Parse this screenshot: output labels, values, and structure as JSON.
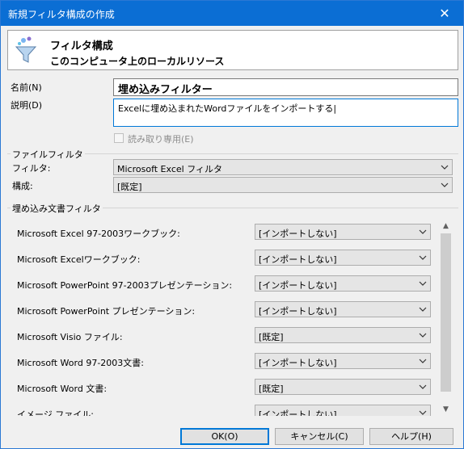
{
  "window": {
    "title": "新規フィルタ構成の作成",
    "close_glyph": "✕"
  },
  "header": {
    "title": "フィルタ構成",
    "subtitle": "このコンピュータ上のローカルリソース",
    "icon": "funnel-icon"
  },
  "form": {
    "name_label": "名前(N)",
    "name_value": "埋め込みフィルター",
    "desc_label": "説明(D)",
    "desc_value": "Excelに埋め込まれたWordファイルをインポートする|",
    "readonly_label": "読み取り専用(E)"
  },
  "file_filter": {
    "group_title": "ファイルフィルタ",
    "filter_label": "フィルタ:",
    "filter_value": "Microsoft Excel フィルタ",
    "config_label": "構成:",
    "config_value": "[既定]"
  },
  "embedded": {
    "group_title": "埋め込み文書フィルタ",
    "rows": [
      {
        "label": "Microsoft Excel 97-2003ワークブック:",
        "value": "[インポートしない]"
      },
      {
        "label": "Microsoft Excelワークブック:",
        "value": "[インポートしない]"
      },
      {
        "label": "Microsoft PowerPoint 97-2003プレゼンテーション:",
        "value": "[インポートしない]"
      },
      {
        "label": "Microsoft PowerPoint プレゼンテーション:",
        "value": "[インポートしない]"
      },
      {
        "label": "Microsoft Visio ファイル:",
        "value": "[既定]"
      },
      {
        "label": "Microsoft Word 97-2003文書:",
        "value": "[インポートしない]"
      },
      {
        "label": "Microsoft Word 文書:",
        "value": "[既定]"
      },
      {
        "label": "イメージ ファイル:",
        "value": "[インポートしない]"
      }
    ]
  },
  "buttons": {
    "ok": "OK(O)",
    "cancel": "キャンセル(C)",
    "help": "ヘルプ(H)"
  },
  "colors": {
    "titlebar": "#0b6ed4",
    "focus_border": "#0078d7"
  }
}
